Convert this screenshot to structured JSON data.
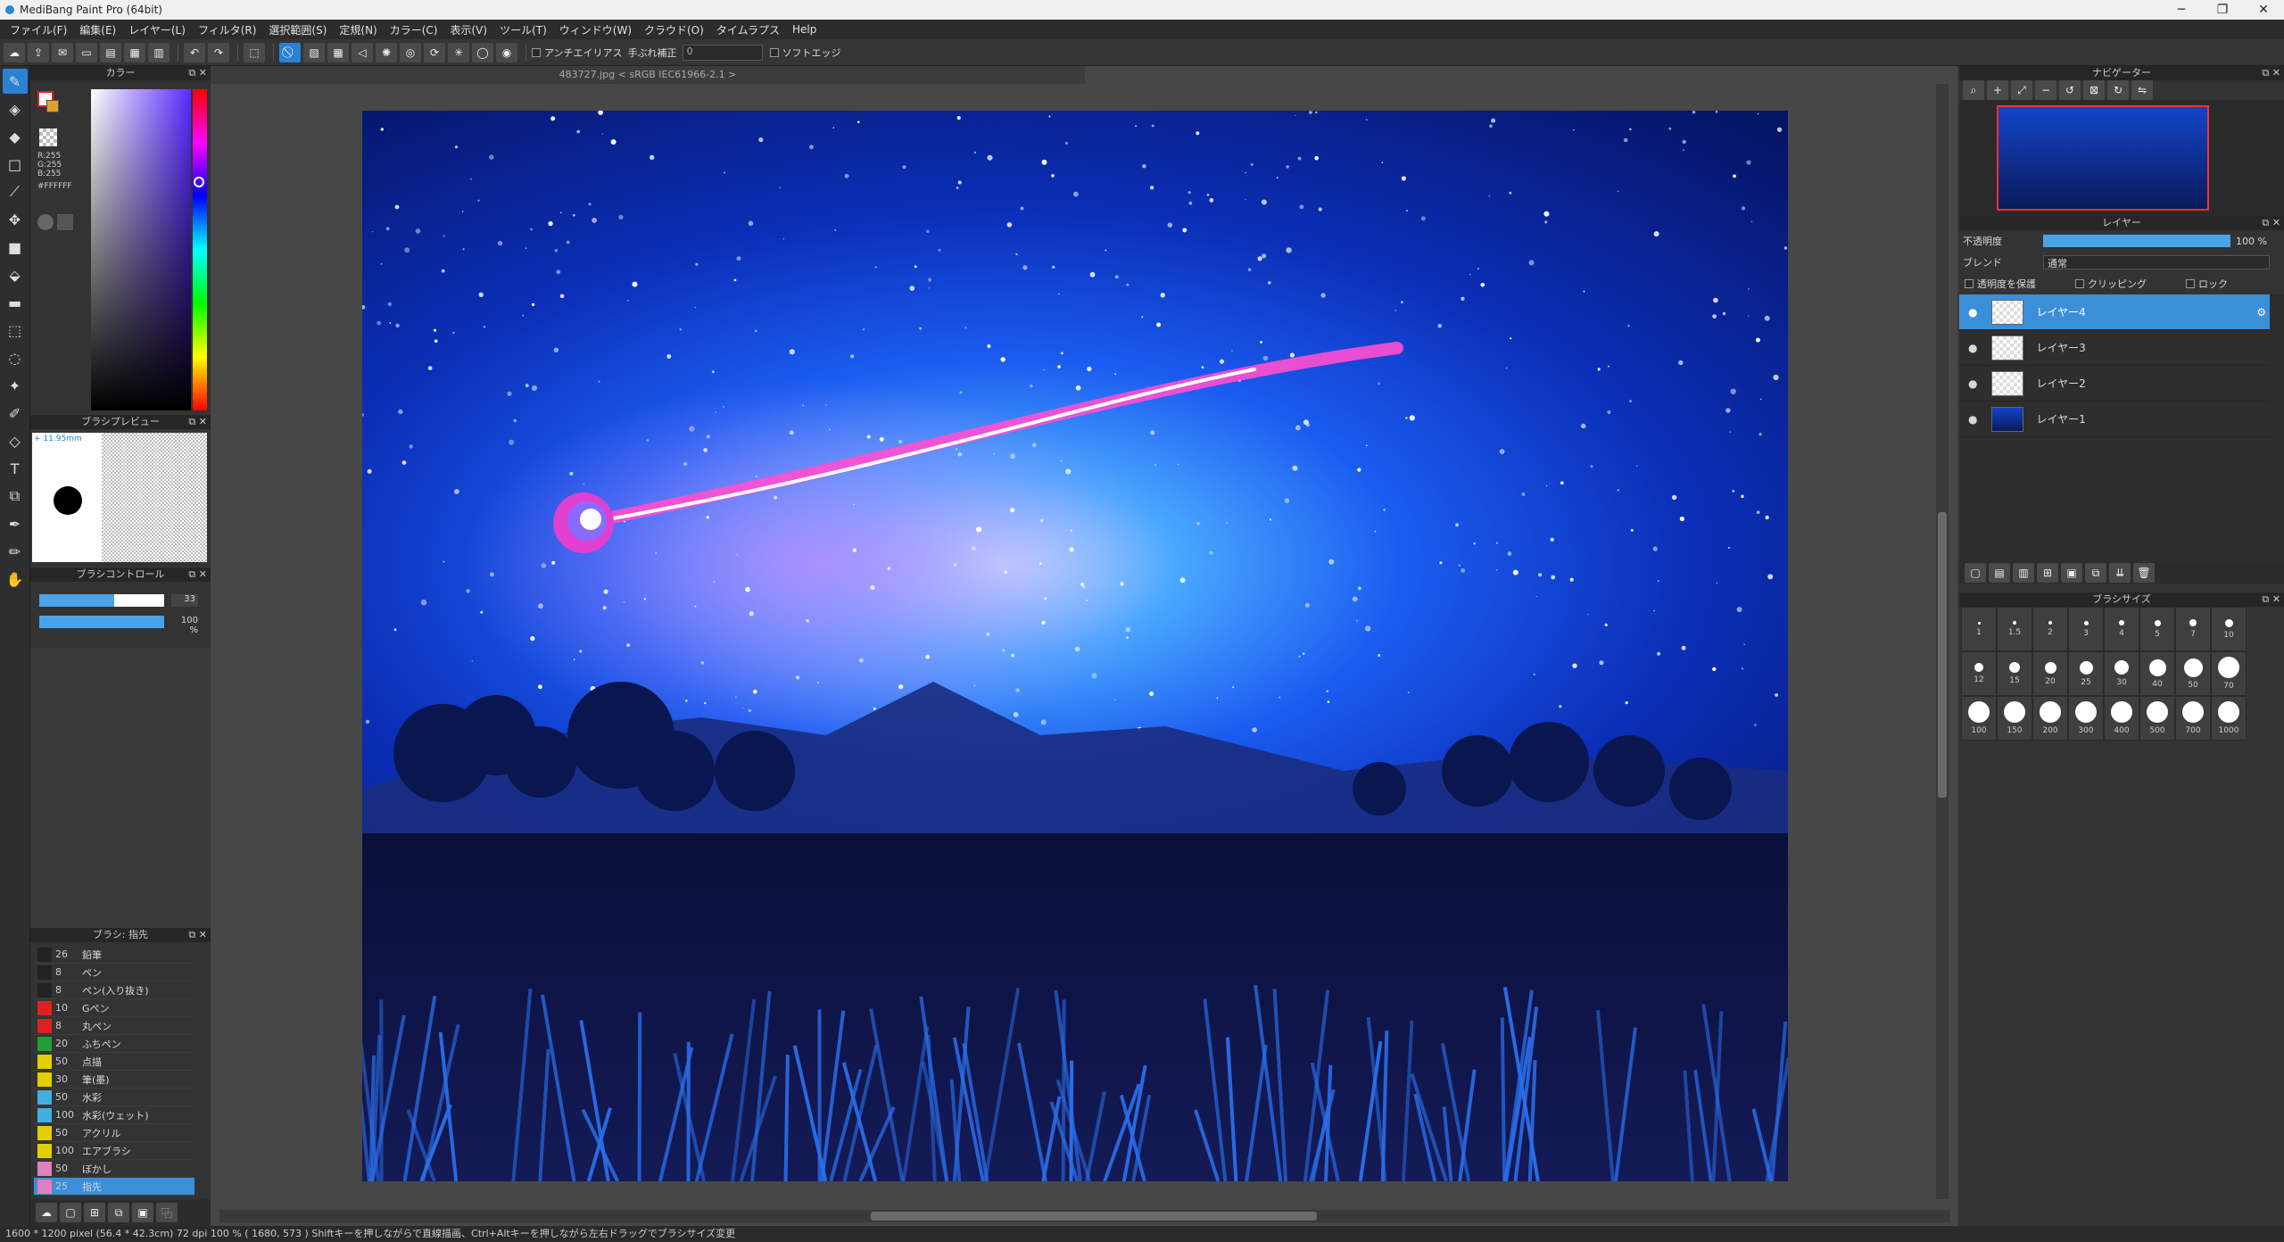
{
  "app": {
    "title": "MediBang Paint Pro (64bit)"
  },
  "window": {
    "minimize": "─",
    "maximize": "❐",
    "close": "✕"
  },
  "menu": [
    "ファイル(F)",
    "編集(E)",
    "レイヤー(L)",
    "フィルタ(R)",
    "選択範囲(S)",
    "定規(N)",
    "カラー(C)",
    "表示(V)",
    "ツール(T)",
    "ウィンドウ(W)",
    "クラウド(O)",
    "タイムラプス",
    "Help"
  ],
  "toolbar": {
    "antialias_label": "アンチエイリアス",
    "stabilizer_label": "手ぶれ補正",
    "stabilizer_value": "0",
    "softedge_label": "ソフトエッジ"
  },
  "color_panel": {
    "title": "カラー",
    "r": "R:255",
    "g": "G:255",
    "b": "B:255",
    "hex": "#FFFFFF"
  },
  "brush_preview": {
    "title": "ブラシプレビュー",
    "size_label": "+ 11.95mm"
  },
  "brush_control": {
    "title": "ブラシコントロール",
    "size_value": "33",
    "opacity_value": "100 %"
  },
  "brush_list": {
    "title": "ブラシ: 指先",
    "items": [
      {
        "size": "26",
        "name": "鉛筆",
        "color": "#222222"
      },
      {
        "size": "8",
        "name": "ペン",
        "color": "#222222"
      },
      {
        "size": "8",
        "name": "ペン(入り抜き)",
        "color": "#222222"
      },
      {
        "size": "10",
        "name": "Gペン",
        "color": "#e02020"
      },
      {
        "size": "8",
        "name": "丸ペン",
        "color": "#e02020"
      },
      {
        "size": "20",
        "name": "ふちペン",
        "color": "#20a030"
      },
      {
        "size": "50",
        "name": "点描",
        "color": "#e0d000"
      },
      {
        "size": "30",
        "name": "筆(墨)",
        "color": "#e0d000"
      },
      {
        "size": "50",
        "name": "水彩",
        "color": "#40b0e0"
      },
      {
        "size": "100",
        "name": "水彩(ウェット)",
        "color": "#40b0e0"
      },
      {
        "size": "50",
        "name": "アクリル",
        "color": "#e0d000"
      },
      {
        "size": "100",
        "name": "エアブラシ",
        "color": "#e0d000"
      },
      {
        "size": "50",
        "name": "ぼかし",
        "color": "#e080c0"
      },
      {
        "size": "25",
        "name": "指先",
        "color": "#e080c0"
      }
    ]
  },
  "document": {
    "tab": "483727.jpg < sRGB IEC61966-2.1 >"
  },
  "navigator": {
    "title": "ナビゲーター"
  },
  "layer_panel": {
    "title": "レイヤー",
    "opacity_label": "不透明度",
    "opacity_value": "100 %",
    "blend_label": "ブレンド",
    "blend_value": "通常",
    "protect_label": "透明度を保護",
    "clipping_label": "クリッピング",
    "lock_label": "ロック",
    "layers": [
      "レイヤー4",
      "レイヤー3",
      "レイヤー2",
      "レイヤー1"
    ]
  },
  "brush_size": {
    "title": "ブラシサイズ",
    "sizes": [
      "1",
      "1.5",
      "2",
      "3",
      "4",
      "5",
      "7",
      "10",
      "12",
      "15",
      "20",
      "25",
      "30",
      "40",
      "50",
      "70",
      "100",
      "150",
      "200",
      "300",
      "400",
      "500",
      "700",
      "1000"
    ]
  },
  "status": {
    "text": "1600 * 1200 pixel   (56.4 * 42.3cm)   72 dpi   100 %   ( 1680, 573 )   Shiftキーを押しながらで直線描画、Ctrl+Altキーを押しながら左右ドラッグでブラシサイズ変更"
  }
}
